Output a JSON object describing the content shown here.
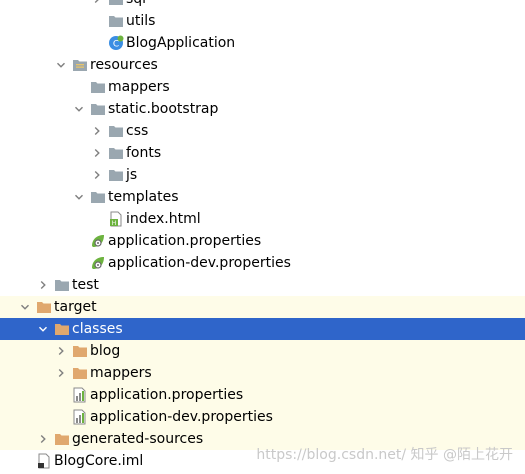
{
  "colors": {
    "selection": "#2f65ca",
    "excluded_bg": "#fefce8",
    "folder": "#9aa7b0",
    "target_folder": "#e0a86e",
    "spring_leaf": "#6db33f"
  },
  "tree": {
    "items": [
      {
        "label": "sql",
        "depth": 6,
        "arrow": "right",
        "icon": "folder-icon"
      },
      {
        "label": "utils",
        "depth": 6,
        "arrow": "none",
        "icon": "folder-icon"
      },
      {
        "label": "BlogApplication",
        "depth": 6,
        "arrow": "none",
        "icon": "spring-class-icon"
      },
      {
        "label": "resources",
        "depth": 4,
        "arrow": "down",
        "icon": "resources-folder-icon"
      },
      {
        "label": "mappers",
        "depth": 5,
        "arrow": "none",
        "icon": "folder-icon"
      },
      {
        "label": "static.bootstrap",
        "depth": 5,
        "arrow": "down",
        "icon": "folder-icon"
      },
      {
        "label": "css",
        "depth": 6,
        "arrow": "right",
        "icon": "folder-icon"
      },
      {
        "label": "fonts",
        "depth": 6,
        "arrow": "right",
        "icon": "folder-icon"
      },
      {
        "label": "js",
        "depth": 6,
        "arrow": "right",
        "icon": "folder-icon"
      },
      {
        "label": "templates",
        "depth": 5,
        "arrow": "down",
        "icon": "folder-icon"
      },
      {
        "label": "index.html",
        "depth": 6,
        "arrow": "none",
        "icon": "html-file-icon"
      },
      {
        "label": "application.properties",
        "depth": 5,
        "arrow": "none",
        "icon": "spring-properties-icon"
      },
      {
        "label": "application-dev.properties",
        "depth": 5,
        "arrow": "none",
        "icon": "spring-properties-icon"
      },
      {
        "label": "test",
        "depth": 3,
        "arrow": "right",
        "icon": "folder-icon"
      },
      {
        "label": "target",
        "depth": 2,
        "arrow": "down",
        "icon": "target-folder-icon",
        "highlight": true
      },
      {
        "label": "classes",
        "depth": 3,
        "arrow": "down",
        "icon": "target-folder-icon",
        "selected": true
      },
      {
        "label": "blog",
        "depth": 4,
        "arrow": "right",
        "icon": "target-folder-icon",
        "highlight": true
      },
      {
        "label": "mappers",
        "depth": 4,
        "arrow": "right",
        "icon": "target-folder-icon",
        "highlight": true
      },
      {
        "label": "application.properties",
        "depth": 4,
        "arrow": "none",
        "icon": "properties-file-icon",
        "highlight": true
      },
      {
        "label": "application-dev.properties",
        "depth": 4,
        "arrow": "none",
        "icon": "properties-file-icon",
        "highlight": true
      },
      {
        "label": "generated-sources",
        "depth": 3,
        "arrow": "right",
        "icon": "target-folder-icon",
        "highlight": true
      },
      {
        "label": "BlogCore.iml",
        "depth": 2,
        "arrow": "none",
        "icon": "iml-file-icon"
      }
    ]
  },
  "watermark": "https://blog.csdn.net/ 知乎 @陌上花开"
}
